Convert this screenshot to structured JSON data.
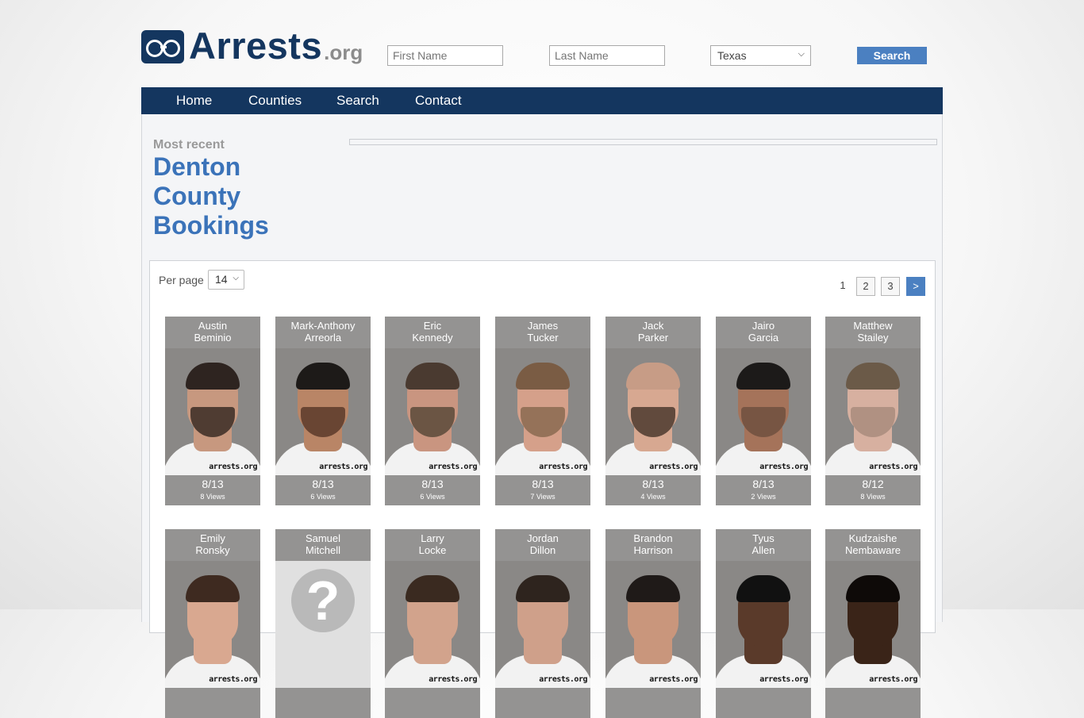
{
  "logo": {
    "main": "Arrests",
    "sub": ".org"
  },
  "header": {
    "first_name_placeholder": "First Name",
    "last_name_placeholder": "Last Name",
    "state_selected": "Texas",
    "search_label": "Search"
  },
  "nav": {
    "items": [
      "Home",
      "Counties",
      "Search",
      "Contact"
    ]
  },
  "page": {
    "kicker": "Most recent",
    "title": "Denton County Bookings"
  },
  "listing": {
    "per_page_label": "Per page",
    "per_page_value": "14",
    "pagination": [
      "1",
      "2",
      "3",
      ">"
    ],
    "current_page": "1",
    "watermark": "arrests.org",
    "cards": [
      {
        "first": "Austin",
        "last": "Beminio",
        "date": "8/13",
        "views": "8 Views",
        "skin": "#c7987f",
        "hair": "#2e2420",
        "beard": "#3a2c24"
      },
      {
        "first": "Mark-Anthony",
        "last": "Arreorla",
        "date": "8/13",
        "views": "6 Views",
        "skin": "#b98566",
        "hair": "#1d1a18",
        "beard": "#5a3a2a"
      },
      {
        "first": "Eric",
        "last": "Kennedy",
        "date": "8/13",
        "views": "6 Views",
        "skin": "#c99580",
        "hair": "#4a3a30",
        "beard": "#5b4a3a"
      },
      {
        "first": "James",
        "last": "Tucker",
        "date": "8/13",
        "views": "7 Views",
        "skin": "#d5a08a",
        "hair": "#7a5c44",
        "beard": "#8a6a50"
      },
      {
        "first": "Jack",
        "last": "Parker",
        "date": "8/13",
        "views": "4 Views",
        "skin": "#d7a891",
        "hair": "#c79c86",
        "beard": "#4c3a2e"
      },
      {
        "first": "Jairo",
        "last": "Garcia",
        "date": "8/13",
        "views": "2 Views",
        "skin": "#a5735a",
        "hair": "#1c1a19",
        "beard": "#6e5040"
      },
      {
        "first": "Matthew",
        "last": "Stailey",
        "date": "8/12",
        "views": "8 Views",
        "skin": "#d7b0a0",
        "hair": "#6b5a48",
        "beard": "#a98c7c"
      },
      {
        "first": "Emily",
        "last": "Ronsky",
        "date": "",
        "views": "",
        "skin": "#d9a890",
        "hair": "#3e2a20",
        "beard": ""
      },
      {
        "first": "Samuel",
        "last": "Mitchell",
        "date": "",
        "views": "",
        "skin": "",
        "hair": "",
        "beard": "",
        "unknown": true
      },
      {
        "first": "Larry",
        "last": "Locke",
        "date": "",
        "views": "",
        "skin": "#d2a38c",
        "hair": "#3a2a20",
        "beard": ""
      },
      {
        "first": "Jordan",
        "last": "Dillon",
        "date": "",
        "views": "",
        "skin": "#cfa08a",
        "hair": "#2e241e",
        "beard": ""
      },
      {
        "first": "Brandon",
        "last": "Harrison",
        "date": "",
        "views": "",
        "skin": "#c9967c",
        "hair": "#1f1a18",
        "beard": ""
      },
      {
        "first": "Tyus",
        "last": "Allen",
        "date": "",
        "views": "",
        "skin": "#5a3a2a",
        "hair": "#111",
        "beard": ""
      },
      {
        "first": "Kudzaishe",
        "last": "Nembaware",
        "date": "",
        "views": "",
        "skin": "#3a2418",
        "hair": "#0e0a08",
        "beard": ""
      }
    ]
  },
  "colors": {
    "brand_navy": "#14365f",
    "accent_blue": "#4b80c1",
    "title_blue": "#3b73b9",
    "card_gray": "#949392"
  }
}
